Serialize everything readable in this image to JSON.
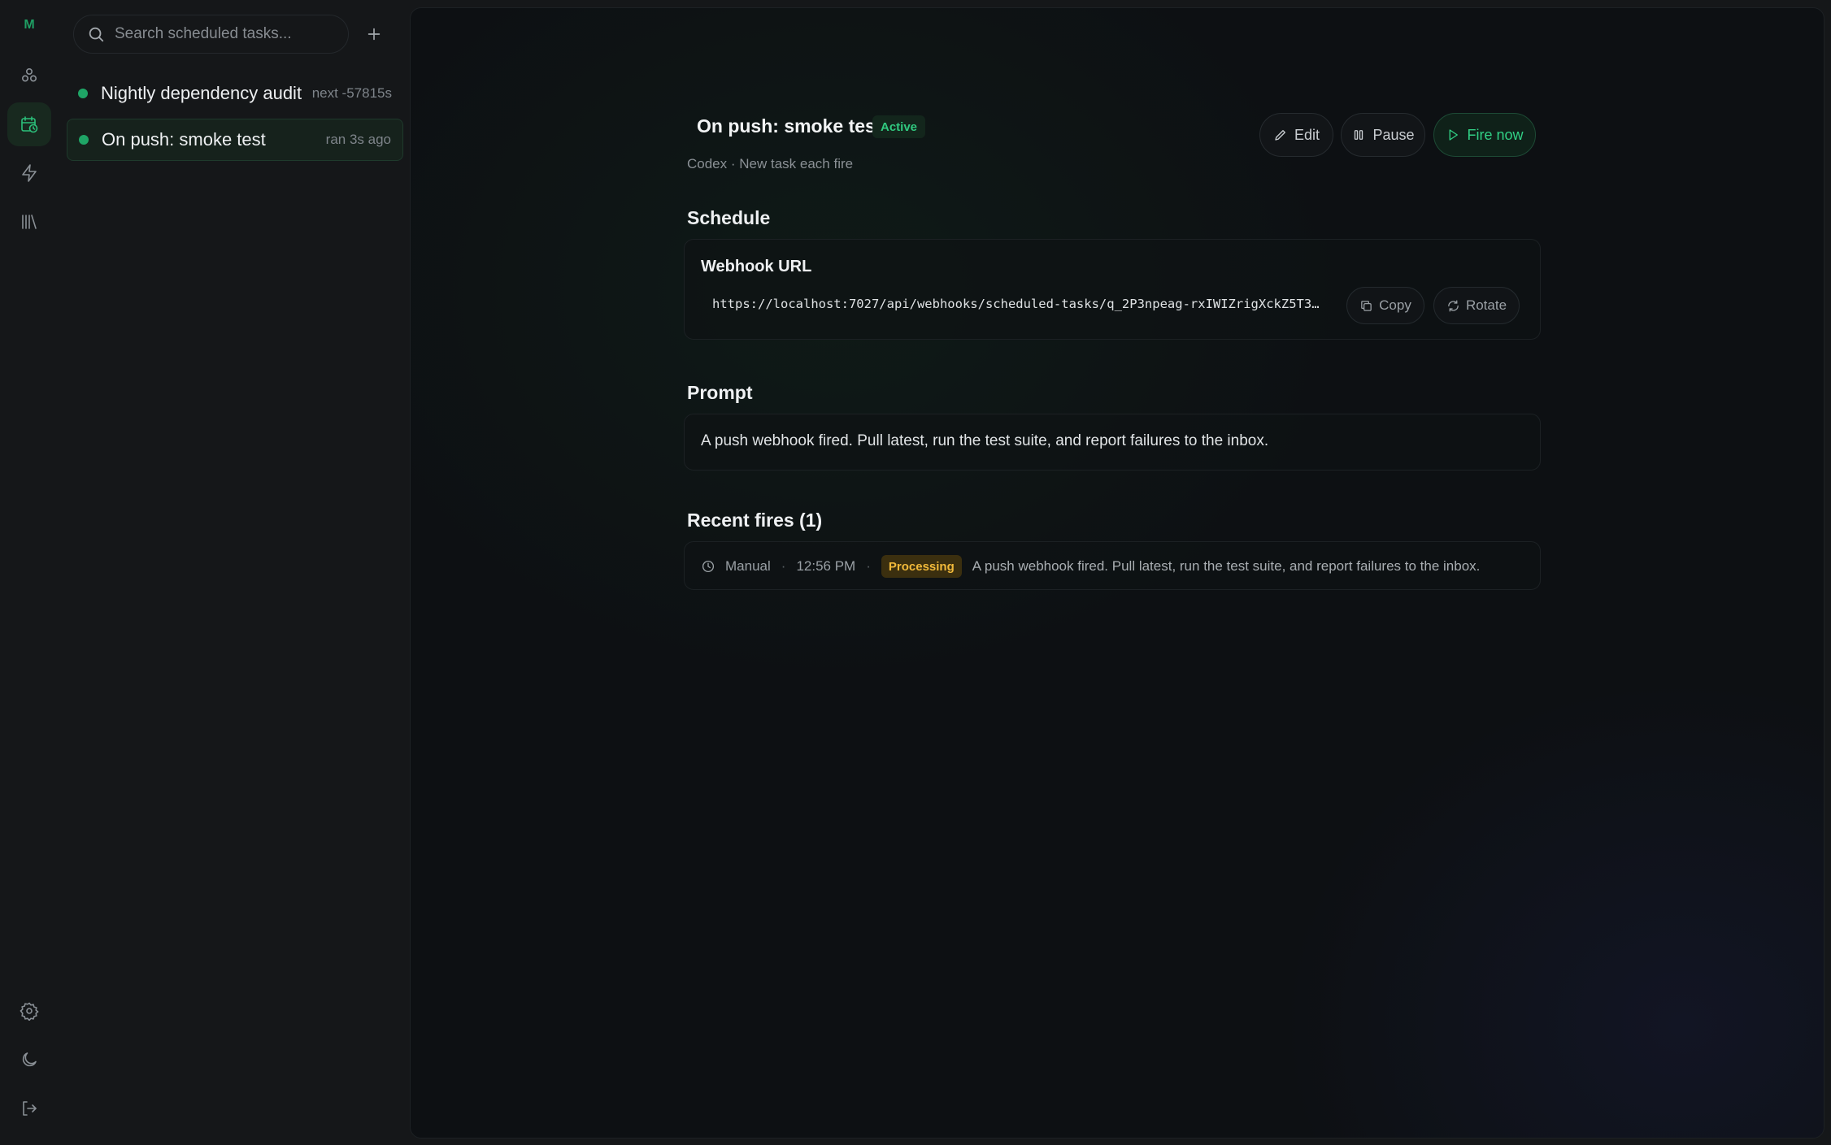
{
  "app": {
    "logo_text": "M"
  },
  "rail": {
    "items": [
      {
        "name": "agents-icon"
      },
      {
        "name": "scheduled-icon",
        "active": true
      },
      {
        "name": "lightning-icon"
      },
      {
        "name": "library-icon"
      }
    ],
    "bottom": [
      {
        "name": "settings-icon"
      },
      {
        "name": "moon-icon"
      },
      {
        "name": "logout-icon"
      }
    ]
  },
  "sidebar": {
    "search_placeholder": "Search scheduled tasks...",
    "tasks": [
      {
        "name": "Nightly dependency audit",
        "meta": "next -57815s",
        "status_color": "#1fa566"
      },
      {
        "name": "On push: smoke test",
        "meta": "ran 3s ago",
        "status_color": "#1fa566",
        "selected": true
      }
    ]
  },
  "detail": {
    "title": "On push: smoke test",
    "status": "Active",
    "subtitle": "Codex · New task each fire",
    "actions": {
      "edit": "Edit",
      "pause": "Pause",
      "fire_now": "Fire now"
    },
    "schedule": {
      "heading": "Schedule",
      "webhook_label": "Webhook URL",
      "webhook_url": "https://localhost:7027/api/webhooks/scheduled-tasks/q_2P3npeag-rxIWIZrigXckZ5T3Ah…",
      "copy_label": "Copy",
      "rotate_label": "Rotate"
    },
    "prompt": {
      "heading": "Prompt",
      "text": "A push webhook fired. Pull latest, run the test suite, and report failures to the inbox."
    },
    "recent_fires": {
      "heading": "Recent fires (1)",
      "items": [
        {
          "trigger": "Manual",
          "time": "12:56 PM",
          "status": "Processing",
          "text": "A push webhook fired. Pull latest, run the test suite, and report failures to the inbox."
        }
      ]
    }
  },
  "colors": {
    "accent": "#2bbf7a",
    "processing": "#f1b93a",
    "background": "#0d1013"
  }
}
